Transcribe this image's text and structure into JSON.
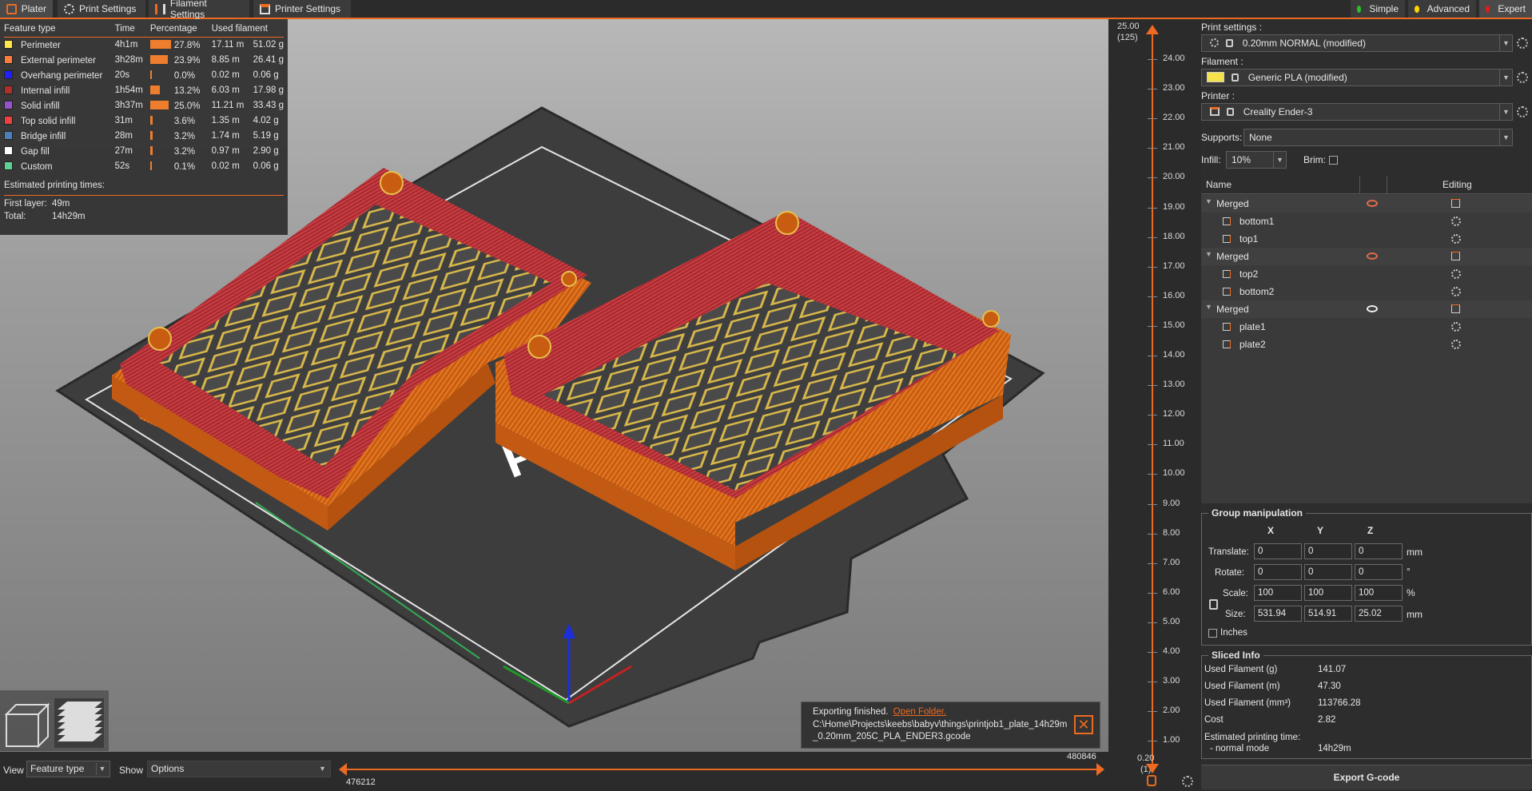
{
  "tabs": [
    {
      "label": "Plater",
      "icon": "plater-icon"
    },
    {
      "label": "Print Settings",
      "icon": "gear-icon"
    },
    {
      "label": "Filament Settings",
      "icon": "spool-icon"
    },
    {
      "label": "Printer Settings",
      "icon": "printer-icon"
    }
  ],
  "modes": [
    {
      "label": "Simple",
      "color": "#29c129"
    },
    {
      "label": "Advanced",
      "color": "#ffd600"
    },
    {
      "label": "Expert",
      "color": "#e21b1b"
    }
  ],
  "legend": {
    "headers": [
      "Feature type",
      "Time",
      "Percentage",
      "Used filament"
    ],
    "rows": [
      {
        "name": "Perimeter",
        "color": "#ffe64d",
        "time": "4h1m",
        "pct": "27.8%",
        "pct_value": 27.8,
        "len": "17.11 m",
        "weight": "51.02 g"
      },
      {
        "name": "External perimeter",
        "color": "#ff7d38",
        "time": "3h28m",
        "pct": "23.9%",
        "pct_value": 23.9,
        "len": "8.85 m",
        "weight": "26.41 g"
      },
      {
        "name": "Overhang perimeter",
        "color": "#1f1fff",
        "time": "20s",
        "pct": "0.0%",
        "pct_value": 0.0,
        "len": "0.02 m",
        "weight": "0.06 g"
      },
      {
        "name": "Internal infill",
        "color": "#b03029",
        "time": "1h54m",
        "pct": "13.2%",
        "pct_value": 13.2,
        "len": "6.03 m",
        "weight": "17.98 g"
      },
      {
        "name": "Solid infill",
        "color": "#9654cc",
        "time": "3h37m",
        "pct": "25.0%",
        "pct_value": 25.0,
        "len": "11.21 m",
        "weight": "33.43 g"
      },
      {
        "name": "Top solid infill",
        "color": "#f04040",
        "time": "31m",
        "pct": "3.6%",
        "pct_value": 3.6,
        "len": "1.35 m",
        "weight": "4.02 g"
      },
      {
        "name": "Bridge infill",
        "color": "#4d80ba",
        "time": "28m",
        "pct": "3.2%",
        "pct_value": 3.2,
        "len": "1.74 m",
        "weight": "5.19 g"
      },
      {
        "name": "Gap fill",
        "color": "#ffffff",
        "time": "27m",
        "pct": "3.2%",
        "pct_value": 3.2,
        "len": "0.97 m",
        "weight": "2.90 g"
      },
      {
        "name": "Custom",
        "color": "#5ed194",
        "time": "52s",
        "pct": "0.1%",
        "pct_value": 0.1,
        "len": "0.02 m",
        "weight": "0.06 g"
      }
    ],
    "est_title": "Estimated printing times:",
    "first_layer_label": "First layer:",
    "first_layer_value": "49m",
    "total_label": "Total:",
    "total_value": "14h29m"
  },
  "bed_text": "Pruc",
  "notification": {
    "message": "Exporting finished.",
    "link": "Open Folder.",
    "path": "C:\\Home\\Projects\\keebs\\babyv\\things\\printjob1_plate_14h29m_0.20mm_205C_PLA_ENDER3.gcode"
  },
  "bottom": {
    "view_label": "View",
    "view_value": "Feature type",
    "show_label": "Show",
    "show_value": "Options",
    "hslider_left": "476212",
    "hslider_right": "480846"
  },
  "vslider": {
    "top_value": "25.00",
    "top_layer": "(125)",
    "bottom_value": "0.20",
    "bottom_layer": "(1)",
    "ticks": [
      "24.00",
      "23.00",
      "22.00",
      "21.00",
      "20.00",
      "19.00",
      "18.00",
      "17.00",
      "16.00",
      "15.00",
      "14.00",
      "13.00",
      "12.00",
      "11.00",
      "10.00",
      "9.00",
      "8.00",
      "7.00",
      "6.00",
      "5.00",
      "4.00",
      "3.00",
      "2.00",
      "1.00"
    ]
  },
  "sidebar": {
    "print_settings_label": "Print settings :",
    "print_settings_value": "0.20mm NORMAL (modified)",
    "filament_label": "Filament :",
    "filament_value": "Generic PLA (modified)",
    "filament_color": "#f5e24a",
    "printer_label": "Printer :",
    "printer_value": "Creality Ender-3",
    "supports_label": "Supports:",
    "supports_value": "None",
    "infill_label": "Infill:",
    "infill_value": "10%",
    "brim_label": "Brim:",
    "objlist_name_header": "Name",
    "objlist_editing_header": "Editing",
    "objects": [
      {
        "name": "Merged",
        "group": true,
        "eye": "hidden"
      },
      {
        "name": "bottom1",
        "group": false
      },
      {
        "name": "top1",
        "group": false
      },
      {
        "name": "Merged",
        "group": true,
        "eye": "hidden"
      },
      {
        "name": "top2",
        "group": false
      },
      {
        "name": "bottom2",
        "group": false
      },
      {
        "name": "Merged",
        "group": true,
        "eye": "visible"
      },
      {
        "name": "plate1",
        "group": false
      },
      {
        "name": "plate2",
        "group": false
      }
    ],
    "group_manip": {
      "title": "Group manipulation",
      "axes": [
        "X",
        "Y",
        "Z"
      ],
      "translate_label": "Translate:",
      "translate": [
        "0",
        "0",
        "0"
      ],
      "translate_unit": "mm",
      "rotate_label": "Rotate:",
      "rotate": [
        "0",
        "0",
        "0"
      ],
      "rotate_unit": "°",
      "scale_label": "Scale:",
      "scale": [
        "100",
        "100",
        "100"
      ],
      "scale_unit": "%",
      "size_label": "Size:",
      "size": [
        "531.94",
        "514.91",
        "25.02"
      ],
      "size_unit": "mm",
      "inches_label": "Inches"
    },
    "sliced_info": {
      "title": "Sliced Info",
      "rows": [
        {
          "label": "Used Filament (g)",
          "value": "141.07"
        },
        {
          "label": "Used Filament (m)",
          "value": "47.30"
        },
        {
          "label": "Used Filament (mm³)",
          "value": "113766.28"
        },
        {
          "label": "Cost",
          "value": "2.82"
        }
      ],
      "est_label": "Estimated printing time:",
      "mode_label": "- normal mode",
      "mode_value": "14h29m"
    },
    "export_label": "Export G-code"
  }
}
